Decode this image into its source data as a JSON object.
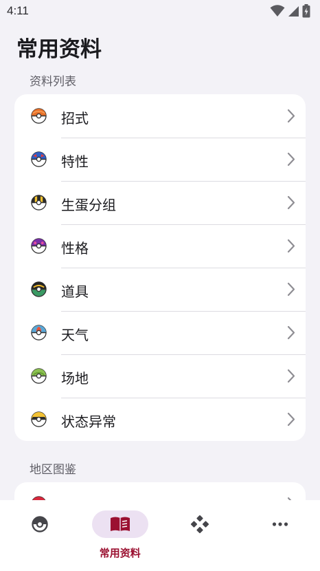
{
  "status_bar": {
    "time": "4:11",
    "icons": [
      "wifi-icon",
      "cellular-signal-icon",
      "battery-icon"
    ]
  },
  "page_title": "常用资料",
  "sections": [
    {
      "header": "资料列表",
      "items": [
        {
          "label": "招式",
          "icon": "poke-ball-icon"
        },
        {
          "label": "特性",
          "icon": "great-ball-icon"
        },
        {
          "label": "生蛋分组",
          "icon": "ultra-ball-icon"
        },
        {
          "label": "性格",
          "icon": "master-ball-icon"
        },
        {
          "label": "道具",
          "icon": "dusk-ball-icon"
        },
        {
          "label": "天气",
          "icon": "dive-ball-icon"
        },
        {
          "label": "场地",
          "icon": "nest-ball-icon"
        },
        {
          "label": "状态异常",
          "icon": "quick-ball-icon"
        }
      ]
    },
    {
      "header": "地区图鉴",
      "items": [
        {
          "label": "",
          "icon": "pokedex-ball-icon"
        }
      ]
    }
  ],
  "bottom_nav": {
    "items": [
      {
        "icon": "pokeball-nav-icon",
        "label": "",
        "active": false
      },
      {
        "icon": "book-icon",
        "label": "常用资料",
        "active": true
      },
      {
        "icon": "gamepad-icon",
        "label": "",
        "active": false
      },
      {
        "icon": "more-icon",
        "label": "",
        "active": false
      }
    ]
  },
  "colors": {
    "background": "#f3f2f7",
    "card": "#ffffff",
    "accent": "#9b1131",
    "active_pill": "#ece1f2",
    "divider": "#dcdbe1"
  }
}
